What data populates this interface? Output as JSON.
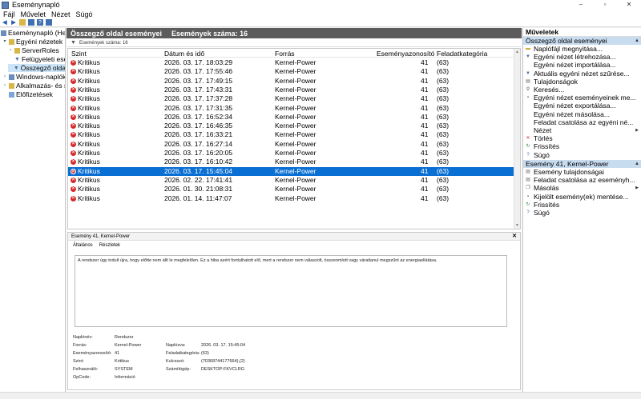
{
  "window": {
    "title": "Eseménynapló",
    "controls": [
      "–",
      "▫",
      "✕"
    ]
  },
  "menu": [
    "Fájl",
    "Művelet",
    "Nézet",
    "Súgó"
  ],
  "tree": [
    {
      "label": "Eseménynapló (Hel",
      "level": 0,
      "expander": ""
    },
    {
      "label": "Egyéni nézetek",
      "level": 0,
      "expander": "▾"
    },
    {
      "label": "ServerRoles",
      "level": 1,
      "expander": "›"
    },
    {
      "label": "Felügyeleti ese",
      "level": 1,
      "expander": ""
    },
    {
      "label": "Összegző olda",
      "level": 1,
      "expander": "",
      "selected": true
    },
    {
      "label": "Windows-naplók",
      "level": 0,
      "expander": "›"
    },
    {
      "label": "Alkalmazás- és s",
      "level": 0,
      "expander": "›"
    },
    {
      "label": "Előfizetések",
      "level": 0,
      "expander": ""
    }
  ],
  "center": {
    "header_title": "Összegző oldal eseményei",
    "header_count": "Események száma: 16",
    "filter_text": "Események száma: 16",
    "columns": [
      "Szint",
      "Dátum és idő",
      "Forrás",
      "Eseményazonosító",
      "Feladatkategória"
    ],
    "rows": [
      {
        "level": "Kritikus",
        "datetime": "2026. 03. 17. 18:03:29",
        "source": "Kernel-Power",
        "id": "41",
        "task": "(63)"
      },
      {
        "level": "Kritikus",
        "datetime": "2026. 03. 17. 17:55:46",
        "source": "Kernel-Power",
        "id": "41",
        "task": "(63)"
      },
      {
        "level": "Kritikus",
        "datetime": "2026. 03. 17. 17:49:15",
        "source": "Kernel-Power",
        "id": "41",
        "task": "(63)"
      },
      {
        "level": "Kritikus",
        "datetime": "2026. 03. 17. 17:43:31",
        "source": "Kernel-Power",
        "id": "41",
        "task": "(63)"
      },
      {
        "level": "Kritikus",
        "datetime": "2026. 03. 17. 17:37:28",
        "source": "Kernel-Power",
        "id": "41",
        "task": "(63)"
      },
      {
        "level": "Kritikus",
        "datetime": "2026. 03. 17. 17:31:35",
        "source": "Kernel-Power",
        "id": "41",
        "task": "(63)"
      },
      {
        "level": "Kritikus",
        "datetime": "2026. 03. 17. 16:52:34",
        "source": "Kernel-Power",
        "id": "41",
        "task": "(63)"
      },
      {
        "level": "Kritikus",
        "datetime": "2026. 03. 17. 16:46:35",
        "source": "Kernel-Power",
        "id": "41",
        "task": "(63)"
      },
      {
        "level": "Kritikus",
        "datetime": "2026. 03. 17. 16:33:21",
        "source": "Kernel-Power",
        "id": "41",
        "task": "(63)"
      },
      {
        "level": "Kritikus",
        "datetime": "2026. 03. 17. 16:27:14",
        "source": "Kernel-Power",
        "id": "41",
        "task": "(63)"
      },
      {
        "level": "Kritikus",
        "datetime": "2026. 03. 17. 16:20:05",
        "source": "Kernel-Power",
        "id": "41",
        "task": "(63)"
      },
      {
        "level": "Kritikus",
        "datetime": "2026. 03. 17. 16:10:42",
        "source": "Kernel-Power",
        "id": "41",
        "task": "(63)"
      },
      {
        "level": "Kritikus",
        "datetime": "2026. 03. 17. 15:45:04",
        "source": "Kernel-Power",
        "id": "41",
        "task": "(63)",
        "selected": true
      },
      {
        "level": "Kritikus",
        "datetime": "2026. 02. 22. 17:41:41",
        "source": "Kernel-Power",
        "id": "41",
        "task": "(63)"
      },
      {
        "level": "Kritikus",
        "datetime": "2026. 01. 30. 21:08:31",
        "source": "Kernel-Power",
        "id": "41",
        "task": "(63)"
      },
      {
        "level": "Kritikus",
        "datetime": "2026. 01. 14. 11:47:07",
        "source": "Kernel-Power",
        "id": "41",
        "task": "(63)"
      }
    ]
  },
  "detail": {
    "title": "Esemény 41, Kernel-Power",
    "tabs": [
      "Általános",
      "Részletek"
    ],
    "message": "A rendszer úgy indult újra, hogy előtte nem állt le megfelelően. Ez a hiba azért fordulhatott elő, mert a rendszer nem válaszolt, összeomlott vagy váratlanul megszűnt az energiaellátása.",
    "fields": {
      "naplonev_label": "Naplónév:",
      "naplonev": "Rendszer",
      "forras_label": "Forrás:",
      "forras": "Kernel-Power",
      "naplozva_label": "Naplózva:",
      "naplozva": "2026. 03. 17. 15:45:04",
      "azon_label": "Eseményazonosító:",
      "azon": "41",
      "feladat_label": "Feladatkategória:",
      "feladat": "(63)",
      "szint_label": "Szint:",
      "szint": "Kritikus",
      "kulcsszo_label": "Kulcsszó:",
      "kulcsszo": "(70368744177664),(2)",
      "felhasznalo_label": "Felhasználó:",
      "felhasznalo": "SYSTEM",
      "szamitogep_label": "Számítógép:",
      "szamitogep": "DESKTOP-FKVCLRG",
      "opcode_label": "OpCode:",
      "opcode": "Információ"
    }
  },
  "actions": {
    "title": "Műveletek",
    "section1": "Összegző oldal eseményei",
    "items1": [
      {
        "label": "Naplófájl megnyitása...",
        "icon": "folder-icon"
      },
      {
        "label": "Egyéni nézet létrehozása...",
        "icon": "filter-icon"
      },
      {
        "label": "Egyéni nézet importálása...",
        "icon": ""
      },
      {
        "label": "Aktuális egyéni nézet szűrése...",
        "icon": "filter-icon"
      },
      {
        "label": "Tulajdonságok",
        "icon": "properties-icon"
      },
      {
        "label": "Keresés...",
        "icon": "find-icon"
      },
      {
        "label": "Egyéni nézet eseményeinek me...",
        "icon": "save-icon"
      },
      {
        "label": "Egyéni nézet exportálása...",
        "icon": ""
      },
      {
        "label": "Egyéni nézet másolása...",
        "icon": ""
      },
      {
        "label": "Feladat csatolása az egyéni né...",
        "icon": ""
      },
      {
        "label": "Nézet",
        "icon": "",
        "submenu": true
      },
      {
        "label": "Törlés",
        "icon": "delete-icon"
      },
      {
        "label": "Frissítés",
        "icon": "refresh-icon"
      },
      {
        "label": "Súgó",
        "icon": "help-icon"
      }
    ],
    "section2": "Esemény 41, Kernel-Power",
    "items2": [
      {
        "label": "Esemény tulajdonságai",
        "icon": "properties-icon"
      },
      {
        "label": "Feladat csatolása az eseményh...",
        "icon": "task-icon"
      },
      {
        "label": "Másolás",
        "icon": "copy-icon",
        "submenu": true
      },
      {
        "label": "Kijelölt esemény(ek) mentése...",
        "icon": "save-icon"
      },
      {
        "label": "Frissítés",
        "icon": "refresh-icon"
      },
      {
        "label": "Súgó",
        "icon": "help-icon"
      }
    ]
  },
  "colors": {
    "selection": "#0a6fd3",
    "header_bar": "#5b5b5b",
    "section_bg": "#c8dcf0",
    "critical": "#d42a2a"
  }
}
